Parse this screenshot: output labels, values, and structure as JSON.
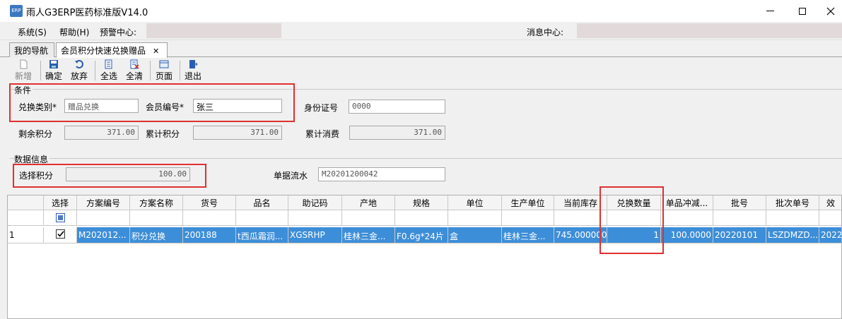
{
  "window": {
    "app_icon_text": "ERP",
    "title": "雨人G3ERP医药标准版V14.0"
  },
  "menu": {
    "system": "系统(S)",
    "help": "帮助(H)",
    "alert_center": "预警中心:",
    "message_center": "消息中心:"
  },
  "tabs": [
    {
      "label": "我的导航"
    },
    {
      "label": "会员积分快速兑换赠品"
    }
  ],
  "toolbar": {
    "new": "新增",
    "confirm": "确定",
    "abandon": "放弃",
    "select_all": "全选",
    "clear_all": "全清",
    "page": "页面",
    "exit": "退出"
  },
  "conditions": {
    "title": "条件",
    "exchange_type_label": "兑换类别*",
    "exchange_type_value": "赠品兑换",
    "member_no_label": "会员编号*",
    "member_no_value": "张三",
    "id_label": "身份证号",
    "id_value": "0000",
    "remaining_points_label": "剩余积分",
    "remaining_points_value": "371.00",
    "total_points_label": "累计积分",
    "total_points_value": "371.00",
    "total_spend_label": "累计消费",
    "total_spend_value": "371.00"
  },
  "data_info": {
    "title": "数据信息",
    "selected_points_label": "选择积分",
    "selected_points_value": "100.00",
    "voucher_flow_label": "单据流水",
    "voucher_flow_value": "M20201200042"
  },
  "grid": {
    "columns": [
      "选择",
      "方案编号",
      "方案名称",
      "货号",
      "品名",
      "助记码",
      "产地",
      "规格",
      "单位",
      "生产单位",
      "当前库存",
      "兑换数量",
      "单品冲减...",
      "批号",
      "批次单号",
      "效"
    ],
    "row": {
      "index": "1",
      "scheme_no": "M202012...",
      "scheme_name": "积分兑换",
      "item_no": "200188",
      "product_name": "t西瓜霜润...",
      "mnemonic": "XGSRHP",
      "origin": "桂林三金...",
      "spec": "F0.6g*24片",
      "unit": "盒",
      "manufacturer": "桂林三金...",
      "stock": "745.000000",
      "exchange_qty": "1",
      "deduction": "100.0000",
      "batch_no": "20220101",
      "batch_order_no": "LSZDMZD...",
      "expiry": "2022"
    }
  }
}
